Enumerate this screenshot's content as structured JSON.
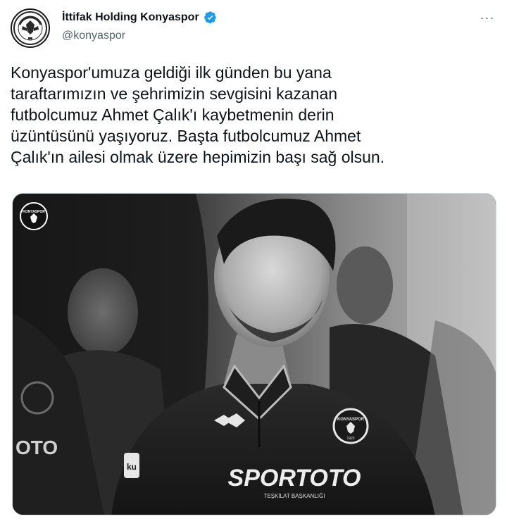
{
  "tweet": {
    "display_name": "İttifak Holding Konyaspor",
    "handle": "@konyaspor",
    "more_label": "···",
    "body_lines": [
      "Konyaspor'umuza geldiği ilk günden bu yana",
      "taraftarımızın ve şehrimizin sevgisini kazanan",
      "futbolcumuz Ahmet Çalık'ı kaybetmenin derin",
      "üzüntüsünü yaşıyoruz. Başta futbolcumuz Ahmet",
      "Çalık'ın ailesi olmak üzere hepimizin başı sağ olsun."
    ]
  },
  "media": {
    "badge_text": "KONYASPOR",
    "sponsor_text": "SPORTOTO",
    "sponsor_subtext": "TEŞKİLAT BAŞKANLIĞI",
    "left_partial_text": "OTO",
    "crest_text": "KONYASPOR",
    "crest_year": "1922",
    "sleeve_text": "ku"
  },
  "colors": {
    "verified": "#1d9bf0",
    "text": "#0f1419",
    "muted": "#536471"
  },
  "icons": {
    "avatar": "konyaspor-crest-icon",
    "verified": "verified-badge-icon",
    "more": "more-options-icon"
  }
}
